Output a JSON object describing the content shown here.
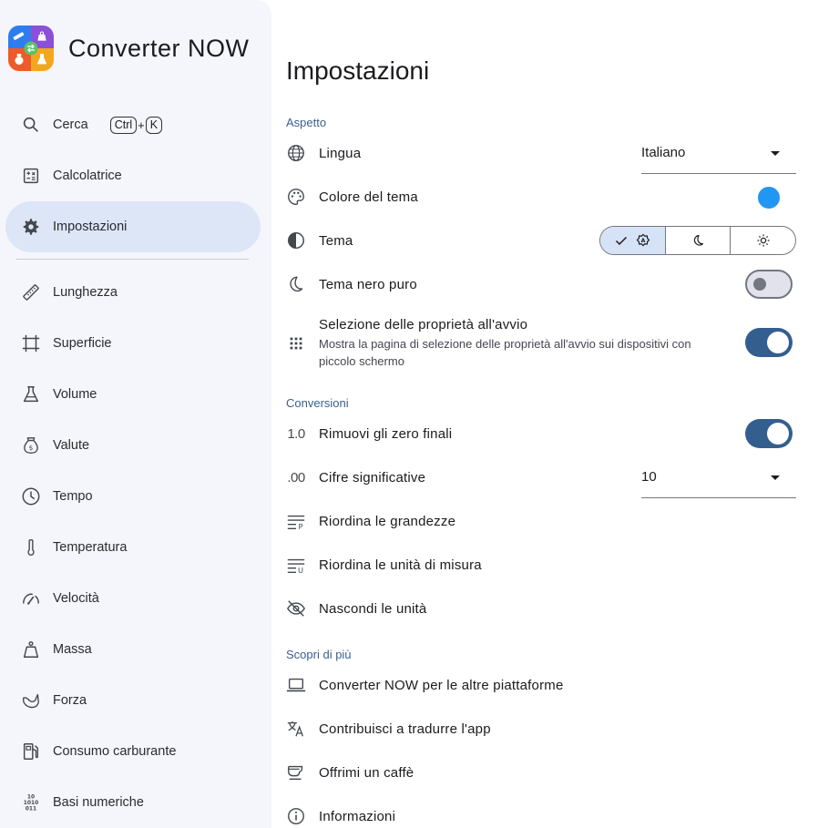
{
  "app": {
    "title": "Converter NOW"
  },
  "sidebar": {
    "search": {
      "label": "Cerca",
      "keys": [
        "Ctrl",
        "+",
        "K"
      ]
    },
    "calculator": {
      "label": "Calcolatrice"
    },
    "settings": {
      "label": "Impostazioni"
    },
    "properties": [
      {
        "label": "Lunghezza",
        "icon": "ruler-icon"
      },
      {
        "label": "Superficie",
        "icon": "area-icon"
      },
      {
        "label": "Volume",
        "icon": "flask-icon"
      },
      {
        "label": "Valute",
        "icon": "money-bag-icon"
      },
      {
        "label": "Tempo",
        "icon": "clock-icon"
      },
      {
        "label": "Temperatura",
        "icon": "thermometer-icon"
      },
      {
        "label": "Velocità",
        "icon": "speedometer-icon"
      },
      {
        "label": "Massa",
        "icon": "weight-icon"
      },
      {
        "label": "Forza",
        "icon": "force-icon"
      },
      {
        "label": "Consumo carburante",
        "icon": "fuel-icon"
      },
      {
        "label": "Basi numeriche",
        "icon": "binary-icon"
      }
    ]
  },
  "main": {
    "title": "Impostazioni",
    "sections": {
      "appearance": "Aspetto",
      "conversions": "Conversioni",
      "discover": "Scopri di più"
    },
    "appearance": {
      "language": {
        "label": "Lingua",
        "value": "Italiano"
      },
      "theme_color": {
        "label": "Colore del tema",
        "color": "#2196f3"
      },
      "theme": {
        "label": "Tema",
        "selected": "auto"
      },
      "pure_black": {
        "label": "Tema nero puro",
        "on": false
      },
      "startup": {
        "label": "Selezione delle proprietà all'avvio",
        "sub": "Mostra la pagina di selezione delle proprietà all'avvio sui dispositivi con piccolo schermo",
        "on": true
      }
    },
    "conversions": {
      "trailing_zeros": {
        "prefix": "1.0",
        "label": "Rimuovi gli zero finali",
        "on": true
      },
      "significant": {
        "prefix": ".00",
        "label": "Cifre significative",
        "value": "10"
      },
      "reorder_props": {
        "label": "Riordina le grandezze"
      },
      "reorder_units": {
        "label": "Riordina le unità di misura"
      },
      "hide_units": {
        "label": "Nascondi le unità"
      }
    },
    "discover": {
      "platforms": {
        "label": "Converter NOW per le altre piattaforme"
      },
      "translate": {
        "label": "Contribuisci a tradurre l'app"
      },
      "coffee": {
        "label": "Offrimi un caffè"
      },
      "about": {
        "label": "Informazioni"
      }
    }
  },
  "colors": {
    "accent": "#335f8f",
    "section_label": "#3a5f8f",
    "sidebar_bg": "#f4f6fb",
    "active_bg": "#dde6f7"
  }
}
